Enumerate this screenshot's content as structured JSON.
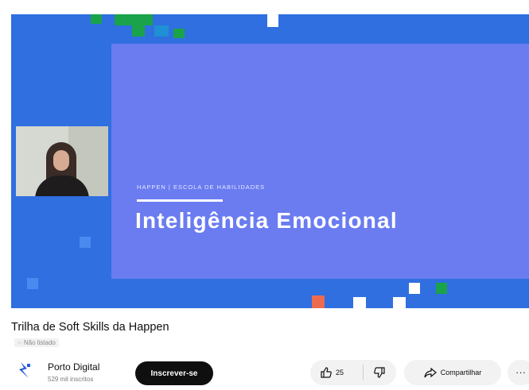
{
  "video": {
    "slide_subtitle": "HAPPEN | ESCOLA DE HABILIDADES",
    "slide_title": "Inteligência Emocional",
    "colors": {
      "frame": "#2f6fe0",
      "slide": "#6a7cf0",
      "accent_green": "#1aa34a",
      "accent_orange": "#ec6b4f"
    }
  },
  "info": {
    "title": "Trilha de Soft Skills da Happen",
    "views_label": "Não listado"
  },
  "channel": {
    "name": "Porto Digital",
    "subscribers": "529 mil inscritos",
    "subscribe_label": "Inscrever-se",
    "icon": "porto-digital-logo-icon"
  },
  "actions": {
    "like_count": "25",
    "share_label": "Compartilhar",
    "like_icon": "thumbs-up-icon",
    "dislike_icon": "thumbs-down-icon",
    "share_icon": "share-arrow-icon",
    "more_icon": "more-horizontal-icon"
  }
}
